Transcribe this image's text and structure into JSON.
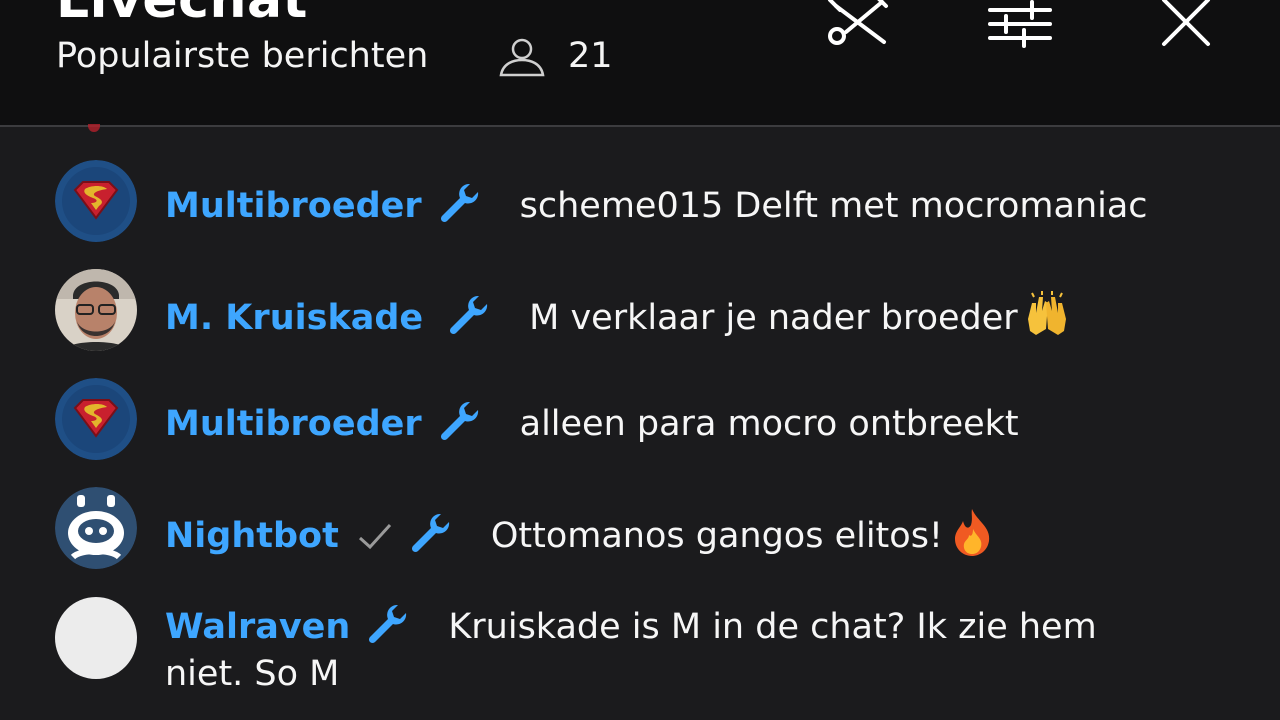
{
  "header": {
    "title": "Livechat",
    "mode": "Populairste berichten",
    "viewer_count": "21",
    "icons": [
      "user-icon",
      "tools-icon",
      "sliders-icon",
      "close-icon"
    ]
  },
  "messages": [
    {
      "author": "Multibroeder",
      "text": "scheme015 Delft met mocromaniac",
      "avatar": "superman-logo"
    },
    {
      "author": "M. Kruiskade",
      "text": "M verklaar je nader broeder",
      "emoji": "raising-hands-emoji",
      "avatar": "photo"
    },
    {
      "author": "Multibroeder",
      "text": "alleen para mocro ontbreekt",
      "avatar": "superman-logo"
    },
    {
      "author": "Nightbot",
      "text": "Ottomanos gangos elitos!",
      "emoji": "fire-emoji",
      "verified": true,
      "avatar": "nightbot-robot"
    },
    {
      "author": "Walraven",
      "text": "Kruiskade is M in de chat? Ik zie hem niet. So M",
      "avatar": "blank"
    }
  ],
  "colors": {
    "background": "#1b1b1d",
    "header": "#0f0f10",
    "author": "#3ea6ff",
    "moderator_badge": "#3ea6ff"
  }
}
